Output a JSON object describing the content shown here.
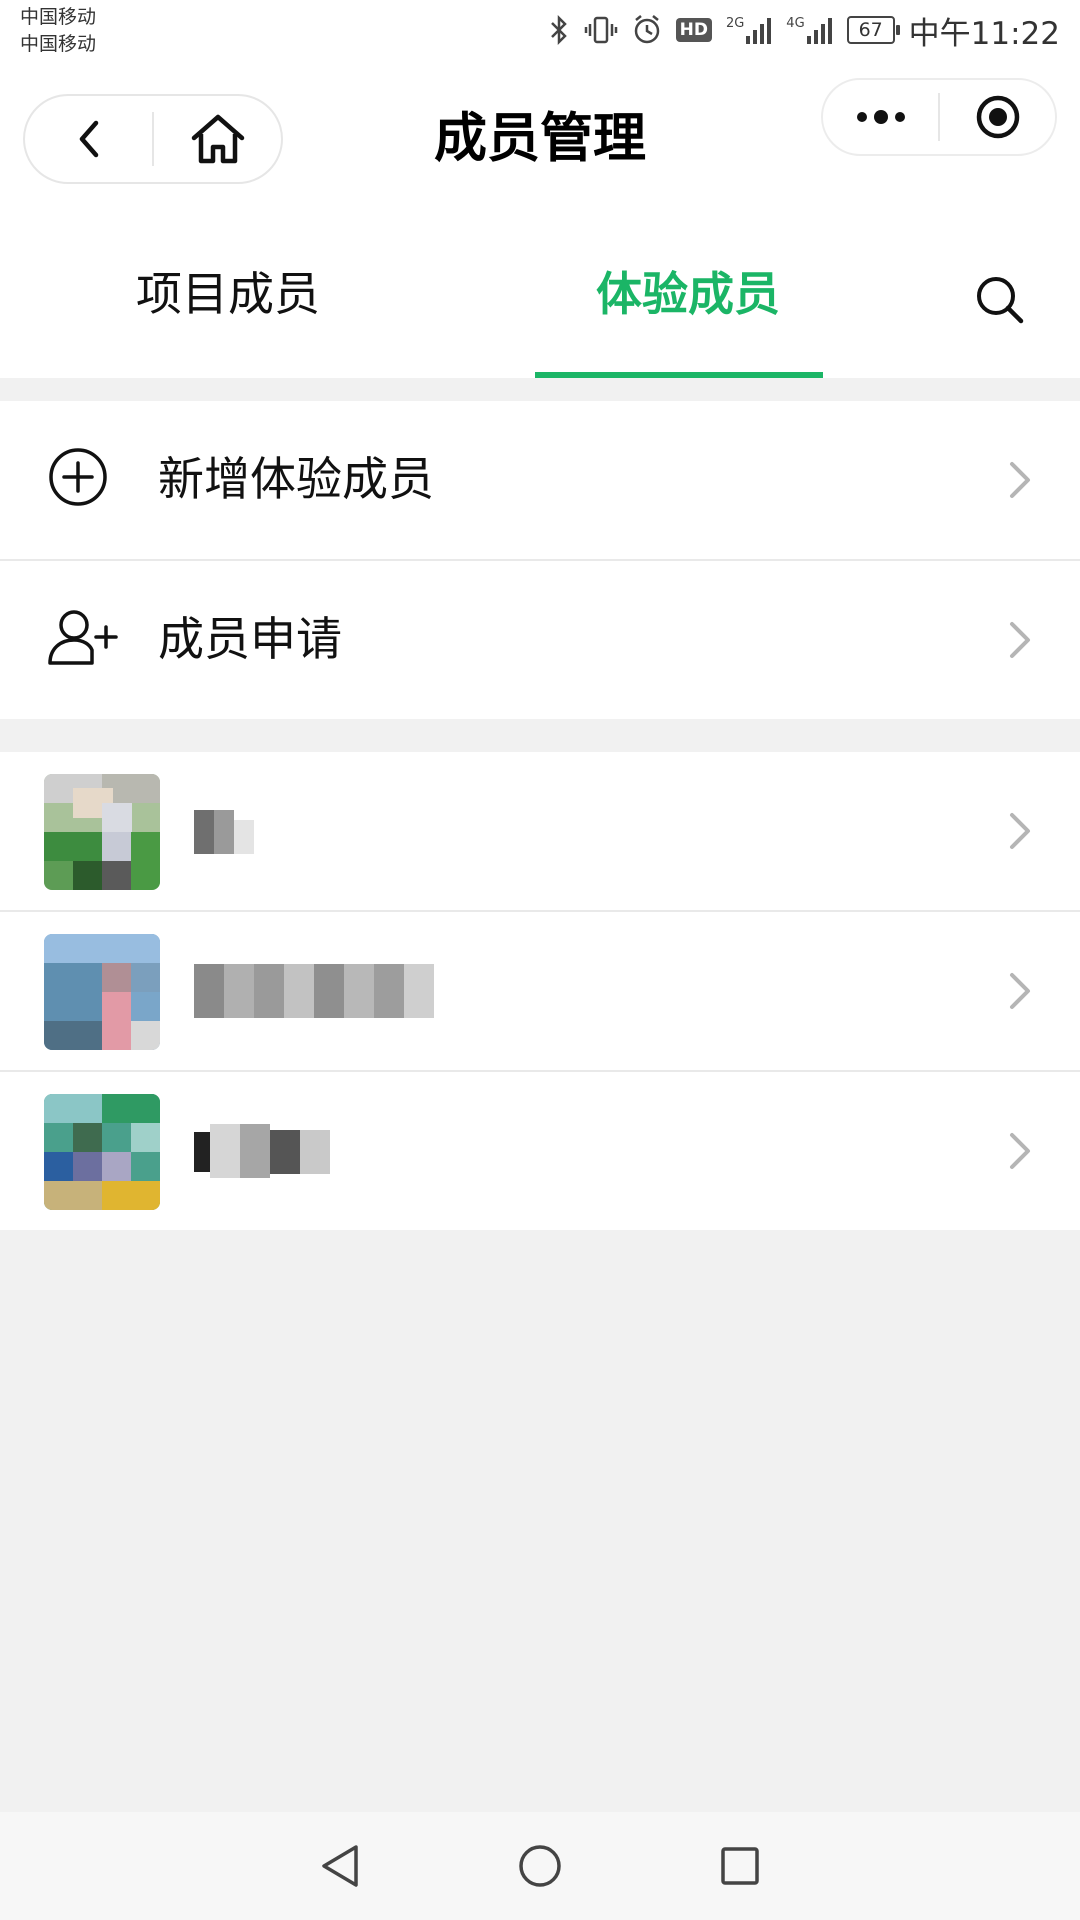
{
  "status_bar": {
    "carrier1": "中国移动",
    "carrier2": "中国移动",
    "network1": "2G",
    "network2": "4G",
    "hd": "HD",
    "battery": "67",
    "time": "中午11:22"
  },
  "navbar": {
    "title": "成员管理",
    "back_icon": "chevron-left-icon",
    "home_icon": "home-icon",
    "more_icon": "more-dots-icon",
    "close_icon": "target-close-icon"
  },
  "tabs": {
    "items": [
      {
        "label": "项目成员",
        "active": false
      },
      {
        "label": "体验成员",
        "active": true
      }
    ],
    "search_icon": "search-icon",
    "accent_color": "#1bb566"
  },
  "actions": [
    {
      "label": "新增体验成员",
      "icon": "add-circle-icon"
    },
    {
      "label": "成员申请",
      "icon": "add-user-icon"
    }
  ],
  "members": [
    {
      "name_visibility": "redacted",
      "avatar": "pixelated-photo"
    },
    {
      "name_visibility": "redacted",
      "avatar": "pixelated-photo"
    },
    {
      "name_visibility": "redacted",
      "avatar": "pixelated-photo"
    }
  ],
  "system_nav": {
    "back_icon": "triangle-back-icon",
    "home_icon": "circle-home-icon",
    "recents_icon": "square-recents-icon"
  }
}
